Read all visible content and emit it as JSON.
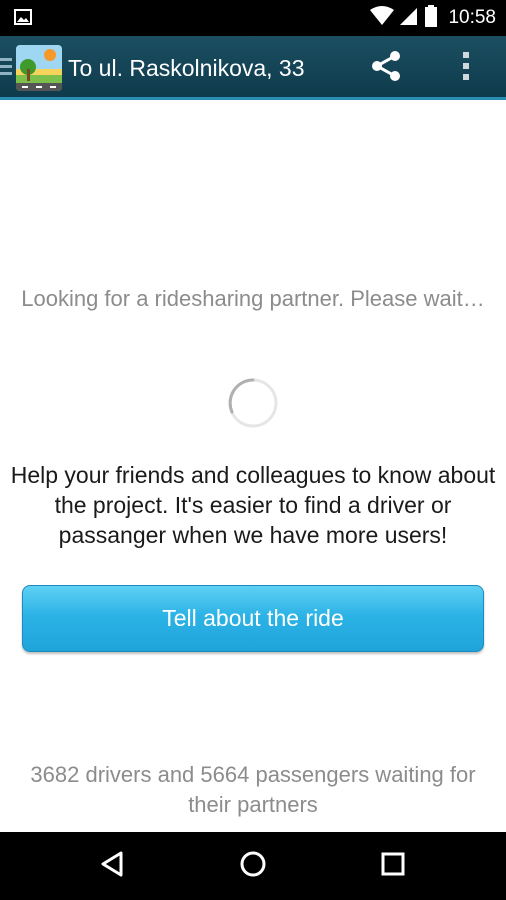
{
  "status_bar": {
    "time": "10:58",
    "icons": [
      "image-notification-icon",
      "wifi-icon",
      "signal-icon",
      "battery-icon"
    ]
  },
  "toolbar": {
    "title": "To ul. Raskolnikova, 33",
    "icons": [
      "drawer-icon",
      "app-logo-icon",
      "share-icon",
      "overflow-menu-icon"
    ],
    "color": "#0e3b4c"
  },
  "main": {
    "waiting_text": "Looking for a ridesharing partner. Please wait…",
    "help_text": "Help your friends and colleagues to know about the project. It's easier to find a driver or passanger when we have more users!",
    "tell_button_label": "Tell about the ride",
    "stats_text": "3682 drivers and 5664 passengers waiting for their partners",
    "accent_color": "#2cb3e6"
  },
  "nav_bar": {
    "icons": [
      "back-icon",
      "home-icon",
      "recents-icon"
    ]
  }
}
